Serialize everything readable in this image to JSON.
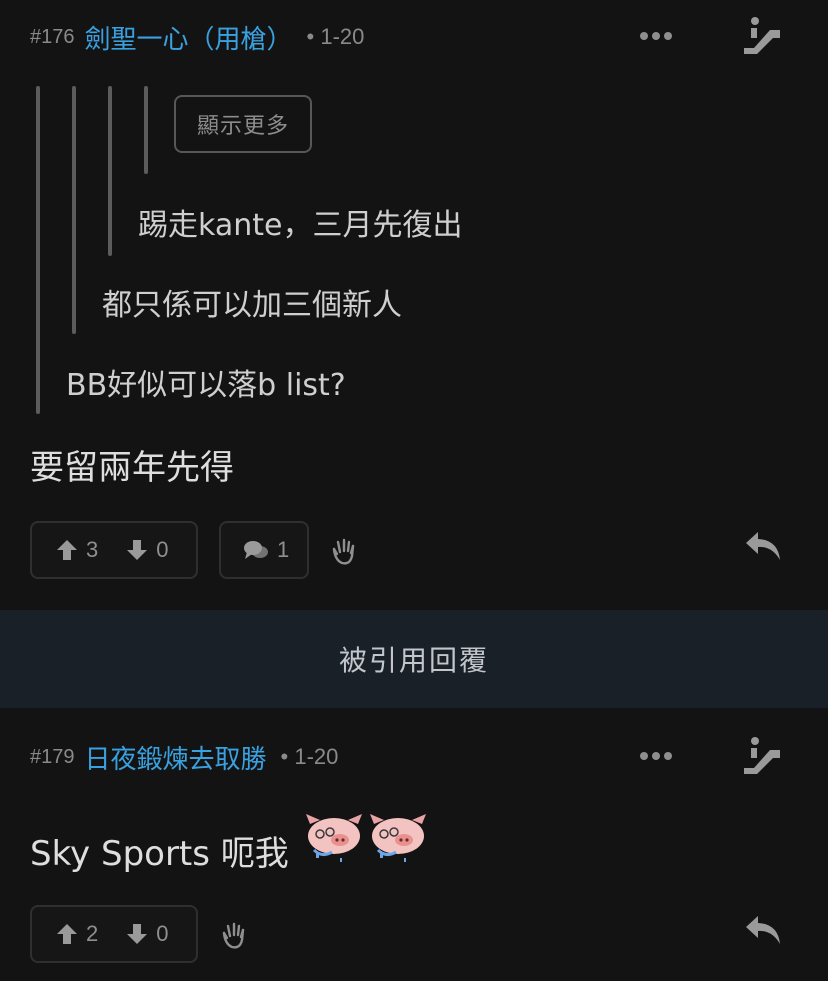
{
  "post176": {
    "number": "#176",
    "username": "劍聖一心（用槍）",
    "date": "• 1-20",
    "show_more_label": "顯示更多",
    "quotes": [
      "踢走kante，三月先復出",
      "都只係可以加三個新人",
      "BB好似可以落b list?"
    ],
    "body": "要留兩年先得",
    "upvotes": "3",
    "downvotes": "0",
    "comments": "1"
  },
  "quoted_replies_label": "被引用回覆",
  "post179": {
    "number": "#179",
    "username": "日夜鍛煉去取勝",
    "date": "• 1-20",
    "body": "Sky Sports 呃我",
    "upvotes": "2",
    "downvotes": "0"
  },
  "colors": {
    "background": "#131313",
    "username": "#3aa1e0",
    "quoted_bar_bg": "#1a2028"
  },
  "icons": [
    "more-dots-icon",
    "escalator-icon",
    "arrow-up-icon",
    "arrow-down-icon",
    "comment-icon",
    "hand-icon",
    "reply-icon",
    "pig-emoji"
  ]
}
